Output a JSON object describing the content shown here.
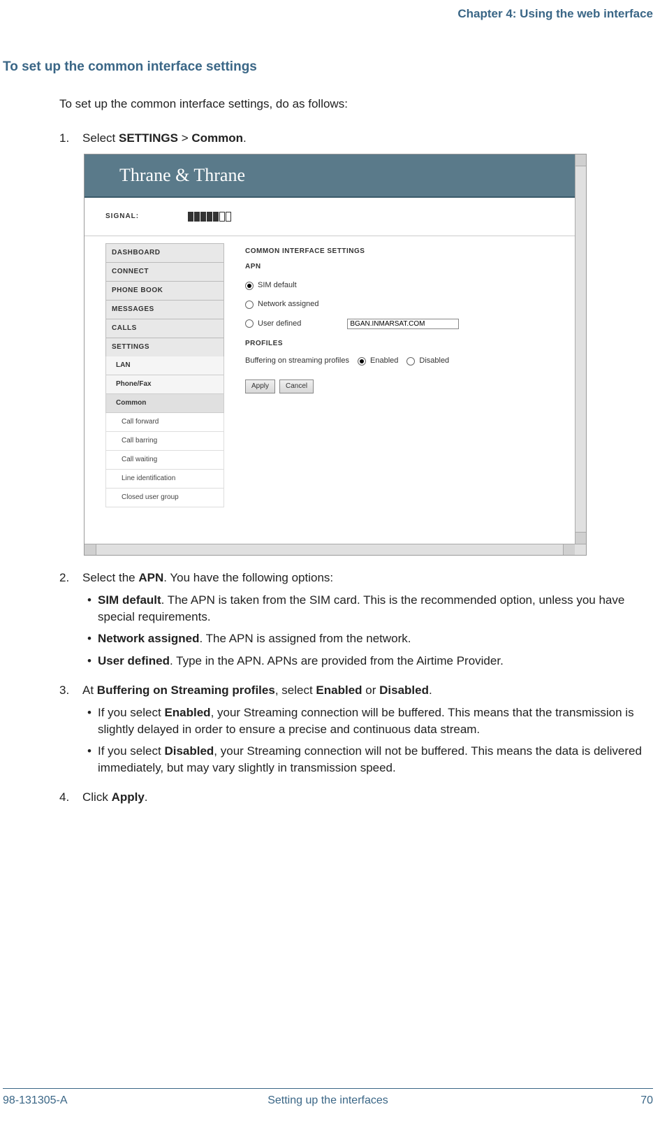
{
  "header": {
    "chapter": "Chapter 4: Using the web interface"
  },
  "section": {
    "title": "To set up the common interface settings"
  },
  "intro": "To set up the common interface settings, do as follows:",
  "steps": {
    "s1": {
      "num": "1.",
      "prefix": "Select ",
      "bold1": "SETTINGS",
      "mid": " > ",
      "bold2": "Common",
      "suffix": "."
    },
    "s2": {
      "num": "2.",
      "prefix": "Select the ",
      "bold": "APN",
      "suffix": ". You have the following options:",
      "b1": {
        "bold": "SIM default",
        "text": ". The APN is taken from the SIM card. This is the recommended option, unless you have special requirements."
      },
      "b2": {
        "bold": "Network assigned",
        "text": ". The APN is assigned from the network."
      },
      "b3": {
        "bold": "User defined",
        "text": ". Type in the APN. APNs are provided from the Airtime Provider."
      }
    },
    "s3": {
      "num": "3.",
      "prefix": "At ",
      "bold1": "Buffering on Streaming profiles",
      "mid": ", select ",
      "bold2": "Enabled",
      "mid2": " or ",
      "bold3": "Disabled",
      "suffix": ".",
      "b1": {
        "prefix": "If you select ",
        "bold": "Enabled",
        "text": ", your Streaming connection will be buffered. This means that the transmission is slightly delayed in order to ensure a precise and continuous data stream."
      },
      "b2": {
        "prefix": "If you select ",
        "bold": "Disabled",
        "text": ", your Streaming connection will not be buffered. This means the data is delivered immediately, but may vary slightly in transmission speed."
      }
    },
    "s4": {
      "num": "4.",
      "prefix": "Click ",
      "bold": "Apply",
      "suffix": "."
    }
  },
  "screenshot": {
    "brand": "Thrane & Thrane",
    "signal_label": "SIGNAL:",
    "nav": {
      "dashboard": "DASHBOARD",
      "connect": "CONNECT",
      "phonebook": "PHONE BOOK",
      "messages": "MESSAGES",
      "calls": "CALLS",
      "settings": "SETTINGS",
      "lan": "LAN",
      "phonefax": "Phone/Fax",
      "common": "Common",
      "callforward": "Call forward",
      "callbarring": "Call barring",
      "callwaiting": "Call waiting",
      "lineid": "Line identification",
      "cug": "Closed user group"
    },
    "main": {
      "title": "COMMON INTERFACE SETTINGS",
      "apn_label": "APN",
      "opt_sim": "SIM default",
      "opt_net": "Network assigned",
      "opt_user": "User defined",
      "user_value": "BGAN.INMARSAT.COM",
      "profiles_label": "PROFILES",
      "buffering_label": "Buffering on streaming profiles",
      "enabled": "Enabled",
      "disabled": "Disabled",
      "apply": "Apply",
      "cancel": "Cancel"
    }
  },
  "footer": {
    "doc": "98-131305-A",
    "section": "Setting up the interfaces",
    "page": "70"
  }
}
